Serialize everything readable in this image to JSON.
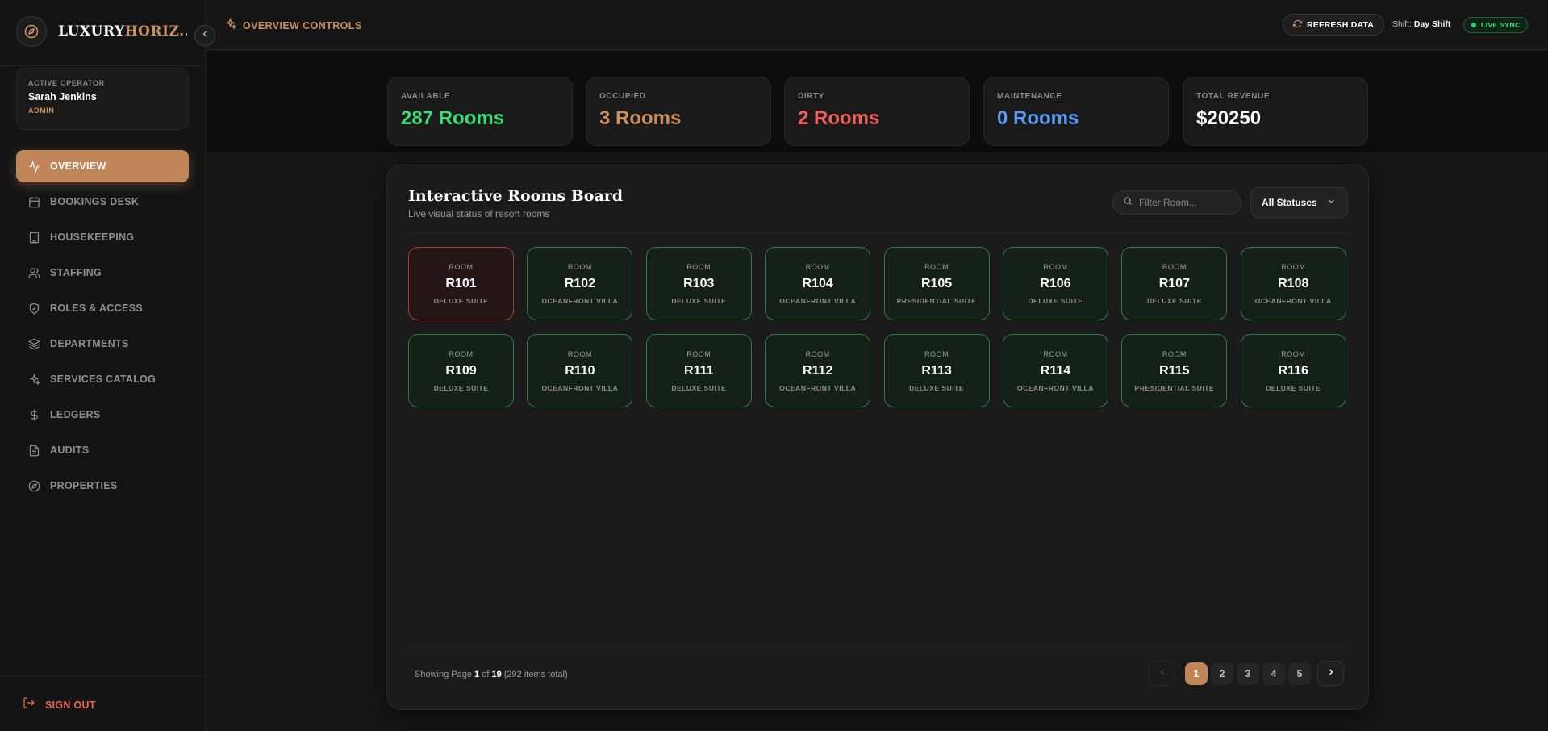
{
  "brand": {
    "name_primary": "LUXURY",
    "name_accent": "HORIZ..."
  },
  "operator": {
    "label": "ACTIVE OPERATOR",
    "name": "Sarah Jenkins",
    "role": "ADMIN"
  },
  "nav": [
    {
      "label": "OVERVIEW",
      "icon": "activity-icon",
      "active": true
    },
    {
      "label": "BOOKINGS DESK",
      "icon": "calendar-icon"
    },
    {
      "label": "HOUSEKEEPING",
      "icon": "building-icon"
    },
    {
      "label": "STAFFING",
      "icon": "users-icon"
    },
    {
      "label": "ROLES & ACCESS",
      "icon": "shield-icon"
    },
    {
      "label": "DEPARTMENTS",
      "icon": "layers-icon"
    },
    {
      "label": "SERVICES CATALOG",
      "icon": "sparkles-icon"
    },
    {
      "label": "LEDGERS",
      "icon": "dollar-icon"
    },
    {
      "label": "AUDITS",
      "icon": "file-icon"
    },
    {
      "label": "PROPERTIES",
      "icon": "compass-icon"
    }
  ],
  "signout": {
    "label": "SIGN OUT"
  },
  "topbar": {
    "title": "OVERVIEW CONTROLS",
    "refresh_label": "REFRESH DATA",
    "shift_label": "Shift:",
    "shift_value": "Day Shift",
    "sync_label": "LIVE SYNC"
  },
  "stats": [
    {
      "label": "AVAILABLE",
      "value": "287 Rooms",
      "color": "#3ddc79"
    },
    {
      "label": "OCCUPIED",
      "value": "3 Rooms",
      "color": "#c98f5f"
    },
    {
      "label": "DIRTY",
      "value": "2 Rooms",
      "color": "#f0605a"
    },
    {
      "label": "MAINTENANCE",
      "value": "0 Rooms",
      "color": "#5b9bf5"
    },
    {
      "label": "TOTAL REVENUE",
      "value": "$20250",
      "color": "#ffffff"
    }
  ],
  "board": {
    "title": "Interactive Rooms Board",
    "subtitle": "Live visual status of resort rooms",
    "filter_placeholder": "Filter Room...",
    "status_filter": "All Statuses",
    "room_caption": "ROOM",
    "rooms": [
      {
        "number": "R101",
        "type": "DELUXE SUITE",
        "status": "dirty"
      },
      {
        "number": "R102",
        "type": "OCEANFRONT VILLA",
        "status": "available"
      },
      {
        "number": "R103",
        "type": "DELUXE SUITE",
        "status": "available"
      },
      {
        "number": "R104",
        "type": "OCEANFRONT VILLA",
        "status": "available"
      },
      {
        "number": "R105",
        "type": "PRESIDENTIAL SUITE",
        "status": "available"
      },
      {
        "number": "R106",
        "type": "DELUXE SUITE",
        "status": "available"
      },
      {
        "number": "R107",
        "type": "DELUXE SUITE",
        "status": "available"
      },
      {
        "number": "R108",
        "type": "OCEANFRONT VILLA",
        "status": "available"
      },
      {
        "number": "R109",
        "type": "DELUXE SUITE",
        "status": "available"
      },
      {
        "number": "R110",
        "type": "OCEANFRONT VILLA",
        "status": "available"
      },
      {
        "number": "R111",
        "type": "DELUXE SUITE",
        "status": "available"
      },
      {
        "number": "R112",
        "type": "OCEANFRONT VILLA",
        "status": "available"
      },
      {
        "number": "R113",
        "type": "DELUXE SUITE",
        "status": "available"
      },
      {
        "number": "R114",
        "type": "OCEANFRONT VILLA",
        "status": "available"
      },
      {
        "number": "R115",
        "type": "PRESIDENTIAL SUITE",
        "status": "available"
      },
      {
        "number": "R116",
        "type": "DELUXE SUITE",
        "status": "available"
      }
    ],
    "pagination": {
      "showing_prefix": "Showing Page",
      "current_page": "1",
      "of_word": "of",
      "total_pages": "19",
      "items_total": "(292 items total)",
      "pages": [
        "1",
        "2",
        "3",
        "4",
        "5"
      ]
    }
  }
}
